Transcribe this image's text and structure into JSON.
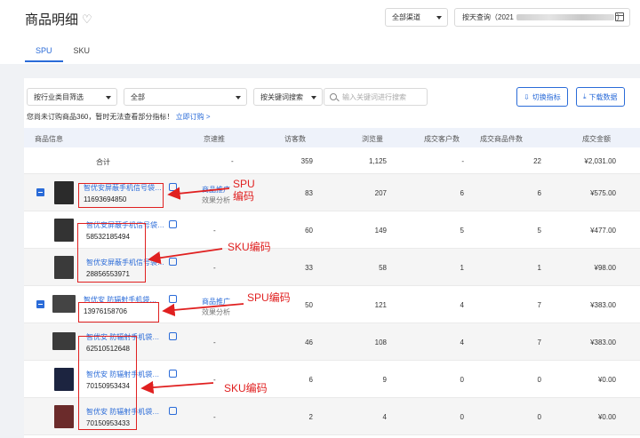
{
  "header": {
    "title": "商品明细",
    "channel": "全部渠道",
    "date_label": "按天查询（2021"
  },
  "tabs": [
    {
      "label": "SPU"
    },
    {
      "label": "SKU"
    }
  ],
  "filters": {
    "industry": "按行业类目筛选",
    "all": "全部",
    "keyword_mode": "按关键词搜索",
    "search_placeholder": "输入关键词进行搜索",
    "switch_label": "切换指标",
    "download_label": "下载数据"
  },
  "notice": {
    "text": "您尚未订购商品360，暂时无法查看部分指标！",
    "link": "立即订购 >"
  },
  "columns": [
    "商品信息",
    "京速推",
    "访客数",
    "浏览量",
    "成交客户数",
    "成交商品件数",
    "成交金额"
  ],
  "total": {
    "label": "合计",
    "jst": "-",
    "visitors": "359",
    "views": "1,125",
    "customers": "-",
    "items": "22",
    "amount": "¥2,031.00"
  },
  "rows": [
    {
      "name": "智优安屏蔽手机信号袋…",
      "code": "11693694850",
      "jst": "商品推广",
      "jst2": "效果分析",
      "visitors": "83",
      "views": "207",
      "customers": "6",
      "items": "6",
      "amount": "¥575.00"
    },
    {
      "name": "智优安屏蔽手机信号袋…",
      "code": "58532185494",
      "jst": "-",
      "visitors": "60",
      "views": "149",
      "customers": "5",
      "items": "5",
      "amount": "¥477.00"
    },
    {
      "name": "智优安屏蔽手机信号袋…",
      "code": "28856553971",
      "jst": "-",
      "visitors": "33",
      "views": "58",
      "customers": "1",
      "items": "1",
      "amount": "¥98.00"
    },
    {
      "name": "智优安 防辐射手机袋…",
      "code": "13976158706",
      "jst": "商品推广",
      "jst2": "效果分析",
      "visitors": "50",
      "views": "121",
      "customers": "4",
      "items": "7",
      "amount": "¥383.00"
    },
    {
      "name": "智优安 防辐射手机袋…",
      "code": "62510512648",
      "jst": "-",
      "visitors": "46",
      "views": "108",
      "customers": "4",
      "items": "7",
      "amount": "¥383.00"
    },
    {
      "name": "智优安 防辐射手机袋…",
      "code": "70150953434",
      "jst": "-",
      "visitors": "6",
      "views": "9",
      "customers": "0",
      "items": "0",
      "amount": "¥0.00"
    },
    {
      "name": "智优安 防辐射手机袋…",
      "code": "70150953433",
      "jst": "-",
      "visitors": "2",
      "views": "4",
      "customers": "0",
      "items": "0",
      "amount": "¥0.00"
    }
  ],
  "annotations": {
    "spu1a": "SPU",
    "spu1b": "编码",
    "sku1": "SKU编码",
    "spu2": "SPU编码",
    "sku2": "SKU编码"
  },
  "colors": {
    "accent": "#2a6bd8",
    "annotation": "#e02020"
  }
}
